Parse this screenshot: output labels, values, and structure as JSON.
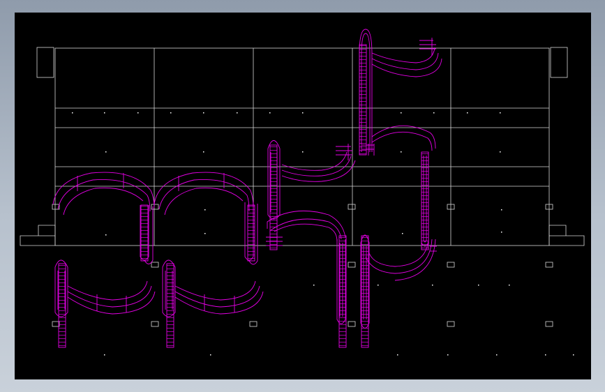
{
  "canvas": {
    "background": "#000000",
    "frame_gradient": [
      "#8f9bab",
      "#c9d1da"
    ]
  },
  "colors": {
    "structure_lines": "#d6d6d6",
    "pipe_lines": "#e600e6",
    "marker_dots": "#ffffff"
  },
  "layers": {
    "building_grid": {
      "bays": 6,
      "rows": 3
    },
    "piping_loops": [
      {
        "id": "loop-upper-right",
        "shape": "s-curve-with-ladder"
      },
      {
        "id": "loop-center-upper",
        "shape": "riser-with-bend"
      },
      {
        "id": "loop-center-lower",
        "shape": "riser-with-bend"
      },
      {
        "id": "loop-left-arch-1",
        "shape": "arch-with-ladder"
      },
      {
        "id": "loop-left-arch-2",
        "shape": "arch-with-ladder"
      },
      {
        "id": "loop-left-lower-1",
        "shape": "riser-with-bend"
      },
      {
        "id": "loop-left-lower-2",
        "shape": "riser-with-bend"
      },
      {
        "id": "loop-right-middle",
        "shape": "arch-with-ladder"
      }
    ]
  }
}
